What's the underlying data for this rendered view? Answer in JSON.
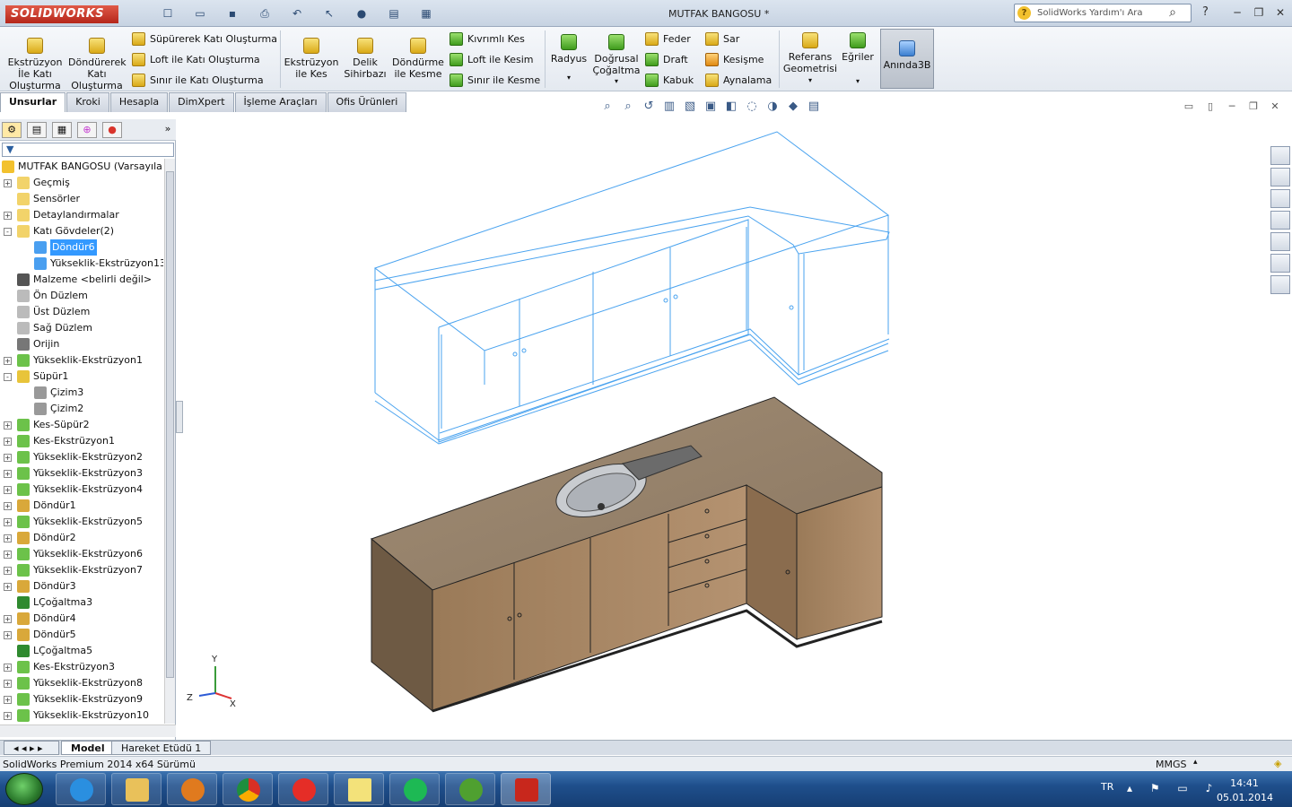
{
  "app": {
    "logo": "SOLIDWORKS",
    "title": "MUTFAK BANGOSU *"
  },
  "help_search": {
    "placeholder": "SolidWorks Yardım'ı Ara"
  },
  "ribbon": {
    "big_buttons": [
      {
        "label": "Ekstrüzyon\nİle Katı\nOluşturma",
        "icon": "extrude-boss-icon"
      },
      {
        "label": "Döndürerek\nKatı\nOluşturma",
        "icon": "revolve-boss-icon"
      },
      {
        "label": "Ekstrüzyon\nile Kes",
        "icon": "extrude-cut-icon"
      },
      {
        "label": "Delik\nSihirbazı",
        "icon": "hole-wizard-icon"
      },
      {
        "label": "Döndürme\nile Kesme",
        "icon": "revolve-cut-icon"
      },
      {
        "label": "Radyus",
        "icon": "fillet-icon"
      },
      {
        "label": "Doğrusal\nÇoğaltma",
        "icon": "linear-pattern-icon"
      },
      {
        "label": "Referans\nGeometrisi",
        "icon": "reference-geometry-icon"
      },
      {
        "label": "Eğriler",
        "icon": "curves-icon"
      },
      {
        "label": "Anında3B",
        "icon": "instant3d-icon"
      }
    ],
    "small_buttons": [
      {
        "label": "Süpürerek Katı Oluşturma",
        "icon": "swept-boss-icon"
      },
      {
        "label": "Loft ile Katı Oluşturma",
        "icon": "lofted-boss-icon"
      },
      {
        "label": "Sınır ile Katı Oluşturma",
        "icon": "boundary-boss-icon"
      },
      {
        "label": "Kıvrımlı Kes",
        "icon": "swept-cut-icon"
      },
      {
        "label": "Loft ile Kesim",
        "icon": "lofted-cut-icon"
      },
      {
        "label": "Sınır ile Kesme",
        "icon": "boundary-cut-icon"
      },
      {
        "label": "Feder",
        "icon": "rib-icon"
      },
      {
        "label": "Draft",
        "icon": "draft-icon"
      },
      {
        "label": "Kabuk",
        "icon": "shell-icon"
      },
      {
        "label": "Sar",
        "icon": "wrap-icon"
      },
      {
        "label": "Kesişme",
        "icon": "intersect-icon"
      },
      {
        "label": "Aynalama",
        "icon": "mirror-icon"
      }
    ]
  },
  "command_tabs": [
    "Unsurlar",
    "Kroki",
    "Hesapla",
    "DimXpert",
    "İşleme Araçları",
    "Ofis Ürünleri"
  ],
  "feature_tree": {
    "root": "MUTFAK BANGOSU  (Varsayıla",
    "items": [
      {
        "label": "Geçmiş",
        "level": 1,
        "expander": "+",
        "icon": "history-icon"
      },
      {
        "label": "Sensörler",
        "level": 1,
        "expander": "",
        "icon": "sensor-icon"
      },
      {
        "label": "Detaylandırmalar",
        "level": 1,
        "expander": "+",
        "icon": "annotations-icon"
      },
      {
        "label": "Katı Gövdeler(2)",
        "level": 1,
        "expander": "-",
        "icon": "solid-bodies-icon"
      },
      {
        "label": "Döndür6",
        "level": 2,
        "expander": "",
        "icon": "body-icon",
        "selected": true
      },
      {
        "label": "Yükseklik-Ekstrüzyon13",
        "level": 2,
        "expander": "",
        "icon": "body-icon"
      },
      {
        "label": "Malzeme <belirli değil>",
        "level": 1,
        "expander": "",
        "icon": "material-icon"
      },
      {
        "label": "Ön Düzlem",
        "level": 1,
        "expander": "",
        "icon": "plane-icon"
      },
      {
        "label": "Üst Düzlem",
        "level": 1,
        "expander": "",
        "icon": "plane-icon"
      },
      {
        "label": "Sağ Düzlem",
        "level": 1,
        "expander": "",
        "icon": "plane-icon"
      },
      {
        "label": "Orijin",
        "level": 1,
        "expander": "",
        "icon": "origin-icon"
      },
      {
        "label": "Yükseklik-Ekstrüzyon1",
        "level": 1,
        "expander": "+",
        "icon": "extrude-icon"
      },
      {
        "label": "Süpür1",
        "level": 1,
        "expander": "-",
        "icon": "sweep-icon"
      },
      {
        "label": "Çizim3",
        "level": 2,
        "expander": "",
        "icon": "sketch-icon"
      },
      {
        "label": "Çizim2",
        "level": 2,
        "expander": "",
        "icon": "sketch-icon"
      },
      {
        "label": "Kes-Süpür2",
        "level": 1,
        "expander": "+",
        "icon": "cut-sweep-icon"
      },
      {
        "label": "Kes-Ekstrüzyon1",
        "level": 1,
        "expander": "+",
        "icon": "cut-extrude-icon"
      },
      {
        "label": "Yükseklik-Ekstrüzyon2",
        "level": 1,
        "expander": "+",
        "icon": "extrude-icon"
      },
      {
        "label": "Yükseklik-Ekstrüzyon3",
        "level": 1,
        "expander": "+",
        "icon": "extrude-icon"
      },
      {
        "label": "Yükseklik-Ekstrüzyon4",
        "level": 1,
        "expander": "+",
        "icon": "extrude-icon"
      },
      {
        "label": "Döndür1",
        "level": 1,
        "expander": "+",
        "icon": "revolve-icon"
      },
      {
        "label": "Yükseklik-Ekstrüzyon5",
        "level": 1,
        "expander": "+",
        "icon": "extrude-icon"
      },
      {
        "label": "Döndür2",
        "level": 1,
        "expander": "+",
        "icon": "revolve-icon"
      },
      {
        "label": "Yükseklik-Ekstrüzyon6",
        "level": 1,
        "expander": "+",
        "icon": "extrude-icon"
      },
      {
        "label": "Yükseklik-Ekstrüzyon7",
        "level": 1,
        "expander": "+",
        "icon": "extrude-icon"
      },
      {
        "label": "Döndür3",
        "level": 1,
        "expander": "+",
        "icon": "revolve-icon"
      },
      {
        "label": "LÇoğaltma3",
        "level": 1,
        "expander": "",
        "icon": "pattern-icon"
      },
      {
        "label": "Döndür4",
        "level": 1,
        "expander": "+",
        "icon": "revolve-icon"
      },
      {
        "label": "Döndür5",
        "level": 1,
        "expander": "+",
        "icon": "revolve-icon"
      },
      {
        "label": "LÇoğaltma5",
        "level": 1,
        "expander": "",
        "icon": "pattern-icon"
      },
      {
        "label": "Kes-Ekstrüzyon3",
        "level": 1,
        "expander": "+",
        "icon": "cut-extrude-icon"
      },
      {
        "label": "Yükseklik-Ekstrüzyon8",
        "level": 1,
        "expander": "+",
        "icon": "extrude-icon"
      },
      {
        "label": "Yükseklik-Ekstrüzyon9",
        "level": 1,
        "expander": "+",
        "icon": "extrude-icon"
      },
      {
        "label": "Yükseklik-Ekstrüzyon10",
        "level": 1,
        "expander": "+",
        "icon": "extrude-icon"
      }
    ]
  },
  "triad": {
    "x": "X",
    "y": "Y",
    "z": "Z"
  },
  "bottom_tabs": [
    "Model",
    "Hareket Etüdü 1"
  ],
  "status": {
    "version": "SolidWorks Premium 2014 x64 Sürümü",
    "units": "MMGS"
  },
  "taskbar": {
    "apps": [
      "internet-explorer-icon",
      "file-explorer-icon",
      "media-player-icon",
      "chrome-icon",
      "yandex-icon",
      "sticky-notes-icon",
      "spotify-icon",
      "utorrent-icon",
      "solidworks-icon"
    ],
    "lang": "TR",
    "time": "14:41",
    "date": "05.01.2014"
  }
}
